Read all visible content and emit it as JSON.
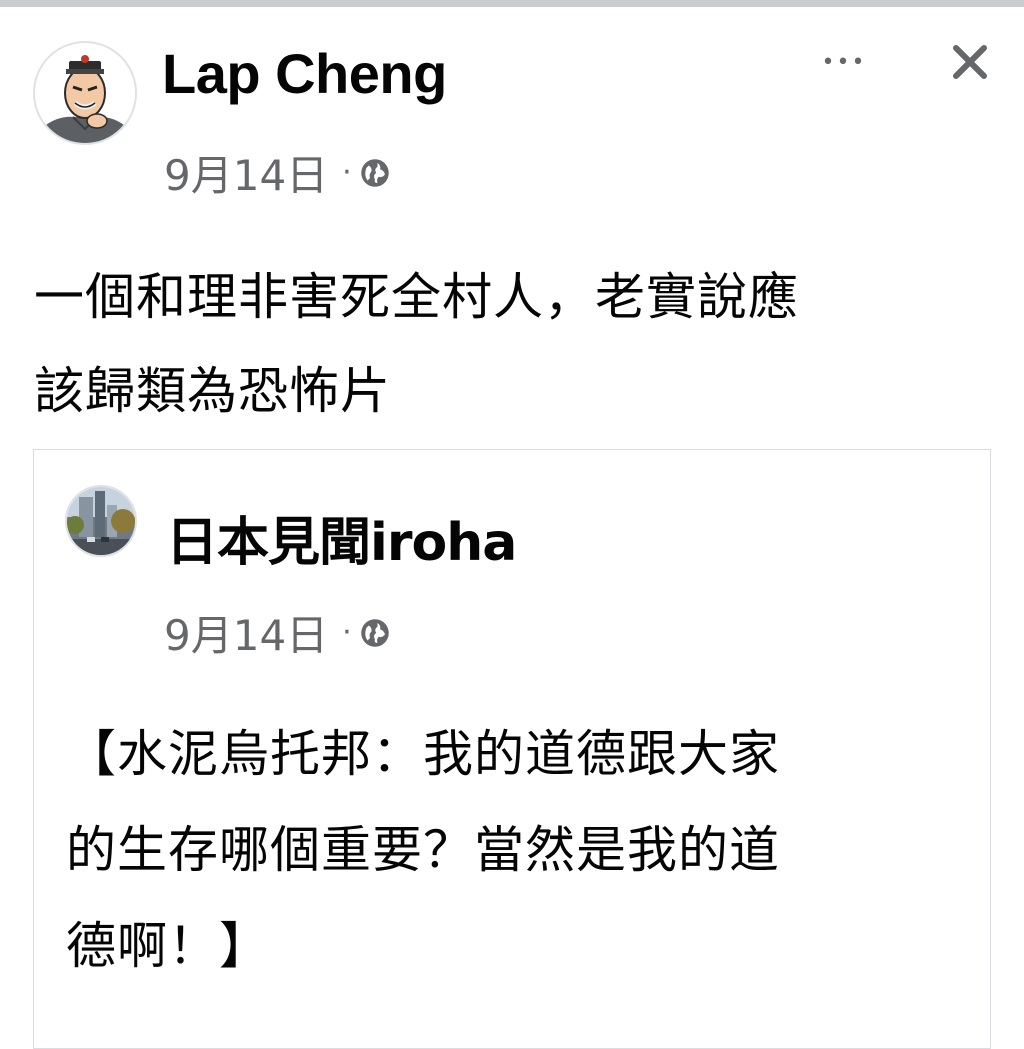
{
  "post": {
    "author_name": "Lap Cheng",
    "date": "9月14日",
    "separator": "·",
    "privacy_icon": "globe-icon",
    "text_lines": [
      "一個和理非害死全村人，老實說應",
      "該歸類為恐怖片"
    ]
  },
  "header_actions": {
    "more_icon": "more-horizontal-icon",
    "more_label": "•••",
    "close_icon": "close-icon"
  },
  "shared_post": {
    "author_name": "日本見聞iroha",
    "date": "9月14日",
    "separator": "·",
    "privacy_icon": "globe-icon",
    "text_lines": [
      "【水泥烏托邦：我的道德跟大家",
      "的生存哪個重要？當然是我的道",
      "德啊！】"
    ]
  },
  "colors": {
    "text_primary": "#050505",
    "text_secondary": "#65676b",
    "card_border": "#dadde1",
    "top_strip": "#c9ccd1"
  }
}
